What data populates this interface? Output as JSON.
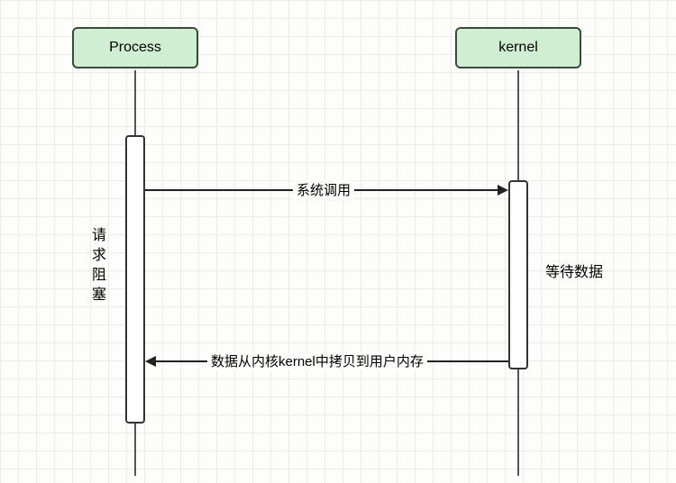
{
  "actors": {
    "process": {
      "label": "Process"
    },
    "kernel": {
      "label": "kernel"
    }
  },
  "messages": {
    "call": "系统调用",
    "return": "数据从内核kernel中拷贝到用户内存"
  },
  "annotations": {
    "left_block": "请求阻塞",
    "right_wait": "等待数据"
  }
}
